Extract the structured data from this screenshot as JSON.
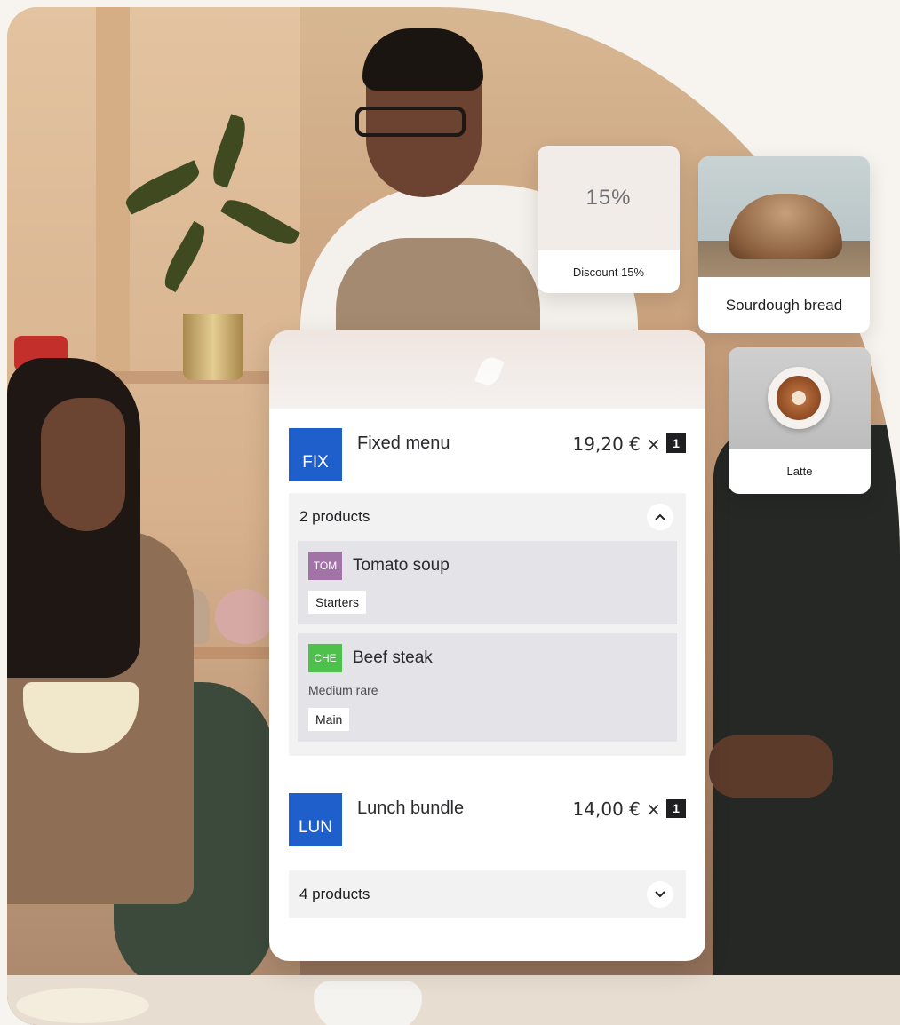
{
  "discount_card": {
    "value": "15%",
    "label": "Discount 15%"
  },
  "bread_card": {
    "label": "Sourdough bread"
  },
  "latte_card": {
    "label": "Latte"
  },
  "orders": [
    {
      "code": "FIX",
      "name": "Fixed menu",
      "price": "19,20 € ×",
      "qty": "1",
      "products_label": "2 products",
      "expanded": true,
      "chevron": "^",
      "items": [
        {
          "code": "TOM",
          "code_color": "#a173a7",
          "name": "Tomato soup",
          "note": "",
          "tag": "Starters"
        },
        {
          "code": "CHE",
          "code_color": "#4ec04c",
          "name": "Beef steak",
          "note": "Medium rare",
          "tag": "Main"
        }
      ]
    },
    {
      "code": "LUN",
      "name": "Lunch bundle",
      "price": "14,00 € ×",
      "qty": "1",
      "products_label": "4 products",
      "expanded": false,
      "chevron": "v"
    }
  ],
  "colors": {
    "code_badge": "#1f5fcc",
    "qty_badge": "#1f1f22"
  }
}
